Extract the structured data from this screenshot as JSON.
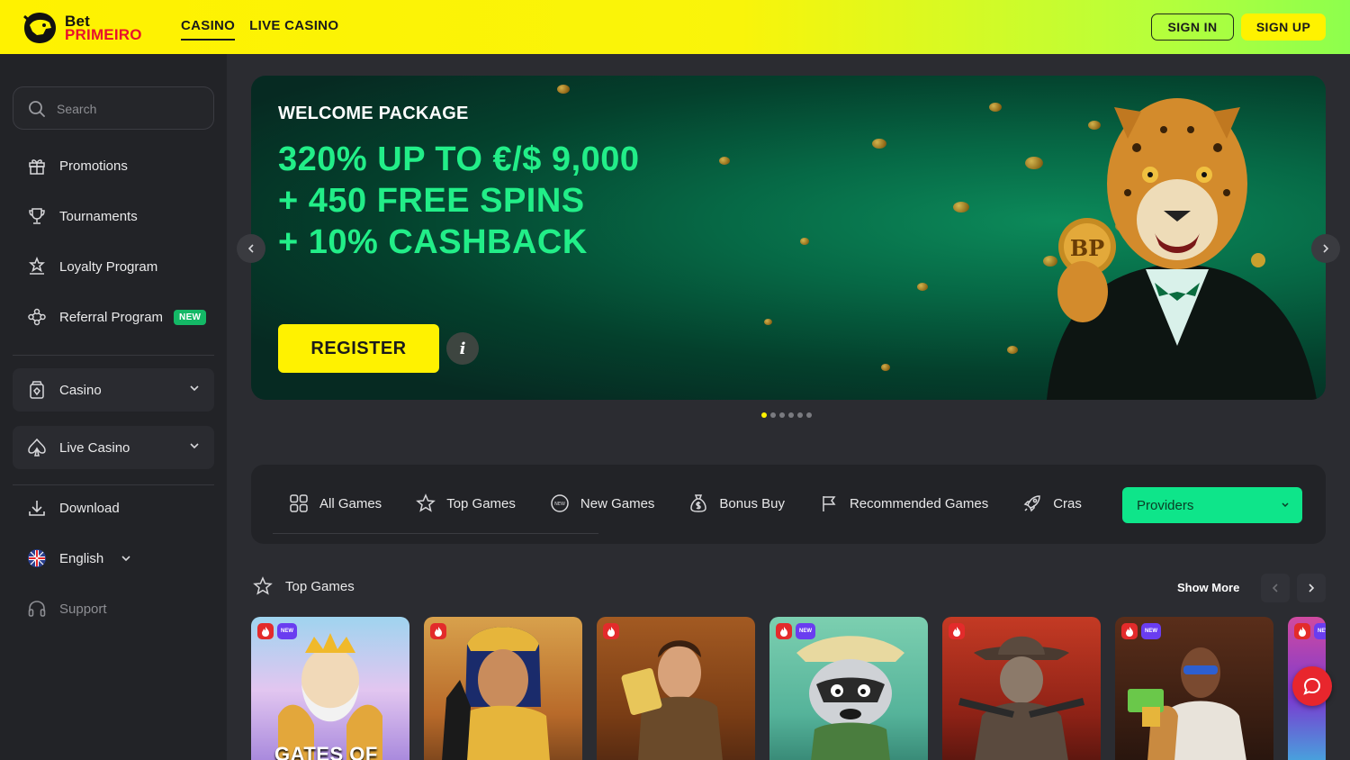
{
  "brand": {
    "logo_line1": "Bet",
    "logo_line2": "PRIMEIRO",
    "colors": {
      "primary_yellow": "#fff200",
      "accent_green": "#22ee88",
      "providers_green": "#0ee58a",
      "hot_red": "#e32b2b",
      "new_purple": "#6a3df0"
    }
  },
  "topnav": {
    "items": [
      {
        "label": "CASINO",
        "active": true
      },
      {
        "label": "LIVE CASINO",
        "active": false
      }
    ],
    "signin_label": "SIGN IN",
    "signup_label": "SIGN UP"
  },
  "sidebar": {
    "search_placeholder": "Search",
    "items": [
      {
        "label": "Promotions",
        "icon": "gift-icon"
      },
      {
        "label": "Tournaments",
        "icon": "trophy-icon"
      },
      {
        "label": "Loyalty Program",
        "icon": "loyalty-icon"
      },
      {
        "label": "Referral Program",
        "icon": "referral-icon",
        "badge": "NEW"
      }
    ],
    "groups": [
      {
        "label": "Casino",
        "icon": "casino-icon"
      },
      {
        "label": "Live Casino",
        "icon": "spade-icon"
      }
    ],
    "download_label": "Download",
    "language_label": "English",
    "support_label": "Support"
  },
  "hero": {
    "title": "WELCOME PACKAGE",
    "line1": "320% UP TO €/$ 9,000",
    "line2": "+ 450 FREE SPINS",
    "line3": "+ 10% CASHBACK",
    "register_label": "REGISTER",
    "info_label": "i",
    "coin_text": "BP",
    "slides": 6,
    "active_slide": 1
  },
  "categories": {
    "items": [
      {
        "label": "All Games",
        "icon": "grid-icon"
      },
      {
        "label": "Top Games",
        "icon": "star-icon"
      },
      {
        "label": "New Games",
        "icon": "new-badge-icon"
      },
      {
        "label": "Bonus Buy",
        "icon": "money-bag-icon"
      },
      {
        "label": "Recommended Games",
        "icon": "flag-icon"
      },
      {
        "label": "Cras",
        "icon": "rocket-icon"
      }
    ],
    "providers_label": "Providers"
  },
  "top_games": {
    "title": "Top Games",
    "show_more": "Show More",
    "tiles": [
      {
        "new": true,
        "label": "GATES OF"
      },
      {
        "new": false
      },
      {
        "new": false
      },
      {
        "new": true
      },
      {
        "new": false
      },
      {
        "new": true
      },
      {
        "new": true
      }
    ],
    "new_tag": "NEW"
  }
}
